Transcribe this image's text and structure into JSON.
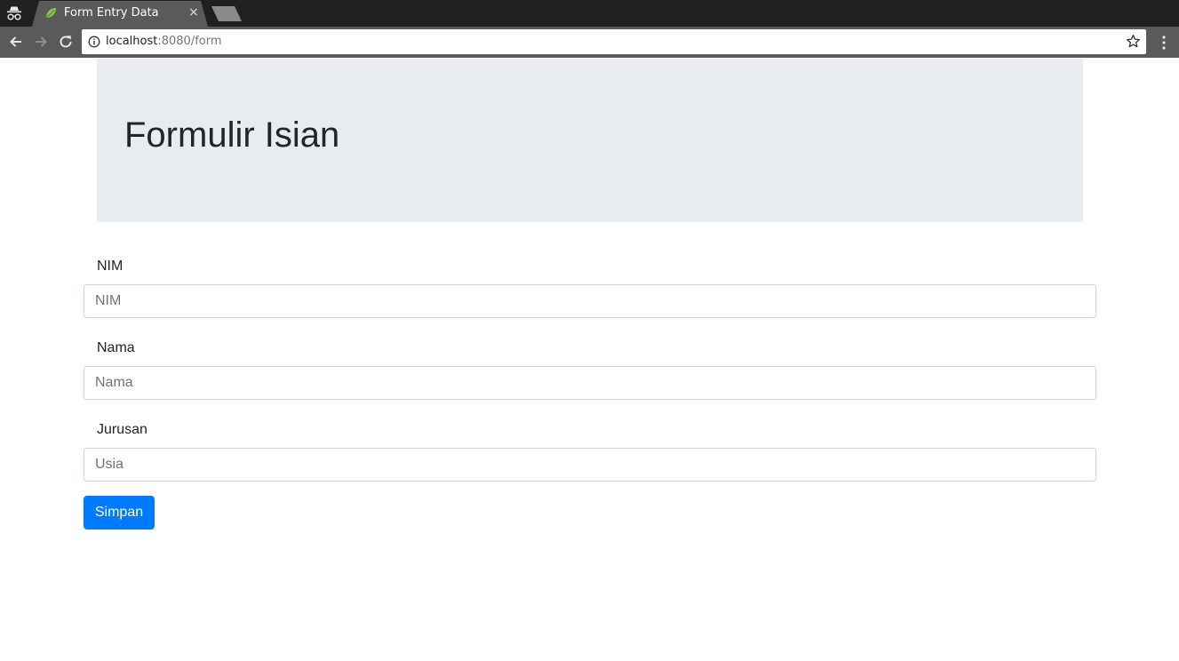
{
  "browser": {
    "tab_title": "Form Entry Data",
    "tab_close_glyph": "×",
    "url_host": "localhost",
    "url_path": ":8080/form",
    "icons": {
      "incognito": "incognito-icon",
      "tab_favicon": "spring-leaf-icon",
      "back": "back-arrow-icon",
      "forward": "forward-arrow-icon",
      "reload": "reload-icon",
      "info": "info-icon",
      "bookmark": "star-icon",
      "menu": "kebab-menu-icon"
    }
  },
  "page": {
    "heading": "Formulir Isian",
    "fields": [
      {
        "label": "NIM",
        "placeholder": "NIM",
        "value": ""
      },
      {
        "label": "Nama",
        "placeholder": "Nama",
        "value": ""
      },
      {
        "label": "Jurusan",
        "placeholder": "Usia",
        "value": ""
      }
    ],
    "submit_label": "Simpan"
  },
  "colors": {
    "primary": "#007bff",
    "jumbotron_bg": "#e9ecef",
    "text": "#212529",
    "placeholder": "#6c757d",
    "input_border": "#ced4da"
  }
}
